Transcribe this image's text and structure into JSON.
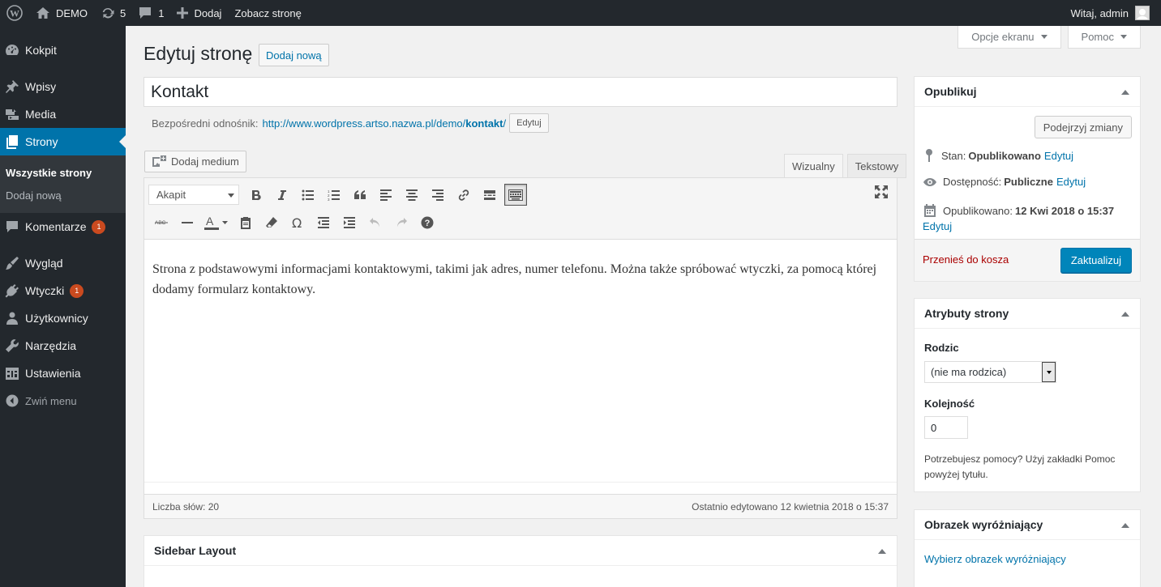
{
  "adminbar": {
    "site_name": "DEMO",
    "updates_count": "5",
    "comments_count": "1",
    "new_label": "Dodaj",
    "view_label": "Zobacz stronę",
    "greeting": "Witaj, admin"
  },
  "menu": {
    "items": [
      {
        "label": "Kokpit",
        "icon": "dashboard-icon"
      },
      {
        "label": "Wpisy",
        "icon": "pin-icon"
      },
      {
        "label": "Media",
        "icon": "media-icon"
      },
      {
        "label": "Strony",
        "icon": "pages-icon"
      },
      {
        "label": "Komentarze",
        "icon": "comment-icon",
        "badge": "1"
      },
      {
        "label": "Wygląd",
        "icon": "appearance-icon"
      },
      {
        "label": "Wtyczki",
        "icon": "plugins-icon",
        "badge": "1"
      },
      {
        "label": "Użytkownicy",
        "icon": "users-icon"
      },
      {
        "label": "Narzędzia",
        "icon": "tools-icon"
      },
      {
        "label": "Ustawienia",
        "icon": "settings-icon"
      },
      {
        "label": "Zwiń menu",
        "icon": "collapse-icon"
      }
    ],
    "submenu": [
      "Wszystkie strony",
      "Dodaj nową"
    ]
  },
  "screen_options": {
    "options_label": "Opcje ekranu",
    "help_label": "Pomoc"
  },
  "page": {
    "heading": "Edytuj stronę",
    "add_new": "Dodaj nową",
    "title_value": "Kontakt",
    "permalink_label": "Bezpośredni odnośnik:",
    "permalink_url": "http://www.wordpress.artso.nazwa.pl/demo/",
    "permalink_slug": "kontakt",
    "permalink_url_end": "/",
    "permalink_edit": "Edytuj"
  },
  "editor": {
    "add_media": "Dodaj medium",
    "tab_visual": "Wizualny",
    "tab_text": "Tekstowy",
    "format_value": "Akapit",
    "content": "Strona z podstawowymi informacjami kontaktowymi, takimi jak adres, numer telefonu. Można także spróbować wtyczki, za pomocą której dodamy formularz kontaktowy.",
    "word_count": "Liczba słów: 20",
    "last_edited": "Ostatnio edytowano 12 kwietnia 2018 o 15:37"
  },
  "sidebar_layout": {
    "title": "Sidebar Layout"
  },
  "publish": {
    "title": "Opublikuj",
    "preview": "Podejrzyj zmiany",
    "status_label": "Stan:",
    "status_value": "Opublikowano",
    "visibility_label": "Dostępność:",
    "visibility_value": "Publiczne",
    "published_label": "Opublikowano:",
    "published_value": "12 Kwi 2018 o 15:37",
    "edit": "Edytuj",
    "trash": "Przenieś do kosza",
    "update": "Zaktualizuj"
  },
  "attributes": {
    "title": "Atrybuty strony",
    "parent_label": "Rodzic",
    "parent_value": "(nie ma rodzica)",
    "order_label": "Kolejność",
    "order_value": "0",
    "help": "Potrzebujesz pomocy? Użyj zakładki Pomoc powyżej tytułu."
  },
  "featured_image": {
    "title": "Obrazek wyróżniający",
    "link": "Wybierz obrazek wyróżniający"
  },
  "colors": {
    "accent": "#0073aa",
    "primary_button": "#0085ba",
    "menu_bg": "#23282d",
    "badge": "#ca4a1f"
  }
}
